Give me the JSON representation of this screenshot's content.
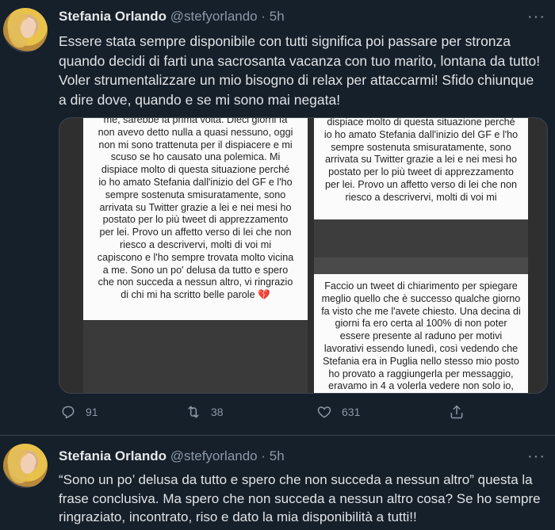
{
  "tweets": [
    {
      "name": "Stefania Orlando",
      "handle": "@stefyorlando",
      "dot": "·",
      "time": "5h",
      "more": "···",
      "text": "Essere stata sempre disponibile con tutti significa poi passare per stronza quando decidi di farti una sacrosanta vacanza con tuo marito, lontana da tutto! Voler strumentalizzare un mio bisogno di relax per attaccarmi! Sfido chiunque a dire dove, quando e se mi sono mai negata!",
      "media": {
        "left_text": "me, sarebbe la prima volta. Dieci giorni fa\nnon avevo detto nulla a quasi nessuno, oggi\nnon mi sono trattenuta per il dispiacere e mi\nscuso se ho causato una polemica. Mi\ndispiace molto di questa situazione perché\nio ho amato Stefania dall'inizio del GF e l'ho\nsempre sostenuta smisuratamente, sono\narrivata su Twitter grazie a lei e nei mesi ho\npostato per lo più tweet di apprezzamento\nper lei. Provo un affetto verso di lei che non\nriesco a descrivervi, molti di voi mi\ncapiscono e l'ho sempre trovata molto vicina\na me. Sono un po' delusa da tutto e spero\nche non succeda a nessun altro, vi ringrazio\ndi chi mi ha scritto belle parole",
        "left_emoji": "💔",
        "right_top_text": "dispiace molto di questa situazione perché\nio ho amato Stefania dall'inizio del GF e l'ho\nsempre sostenuta smisuratamente, sono\narrivata su Twitter grazie a lei e nei mesi ho\npostato per lo più tweet di apprezzamento\nper lei. Provo un affetto verso di lei che non\nriesco a descrivervi, molti di voi mi",
        "right_bottom_text": "Faccio un tweet di chiarimento per spiegare\nmeglio quello che è successo qualche giorno\nfa visto che me l'avete chiesto. Una decina di\ngiorni fa ero certa al 100% di non poter\nessere presente al raduno per motivi\nlavorativi essendo lunedì, così vedendo che\nStefania era in Puglia nello stesso mio posto\nho provato a raggiungerla per messaggio,\neravamo in 4 a volerla vedere non solo io,"
      },
      "actions": {
        "replies": "91",
        "retweets": "38",
        "likes": "631"
      }
    },
    {
      "name": "Stefania Orlando",
      "handle": "@stefyorlando",
      "dot": "·",
      "time": "5h",
      "more": "···",
      "text": "“Sono un po’ delusa da tutto e spero che non succeda a nessun altro” questa la frase conclusiva. Ma spero che non succeda a nessun altro cosa? Se ho sempre ringraziato, incontrato, riso e dato la mia disponibilità a tutti!!"
    }
  ],
  "icons": {
    "reply": "reply-icon",
    "retweet": "retweet-icon",
    "like": "heart-icon",
    "share": "share-icon",
    "more": "more-icon"
  },
  "colors": {
    "background": "#15202b",
    "secondary_text": "#8b98a5",
    "primary_text": "#e7e9ea",
    "divider": "#38444d"
  }
}
